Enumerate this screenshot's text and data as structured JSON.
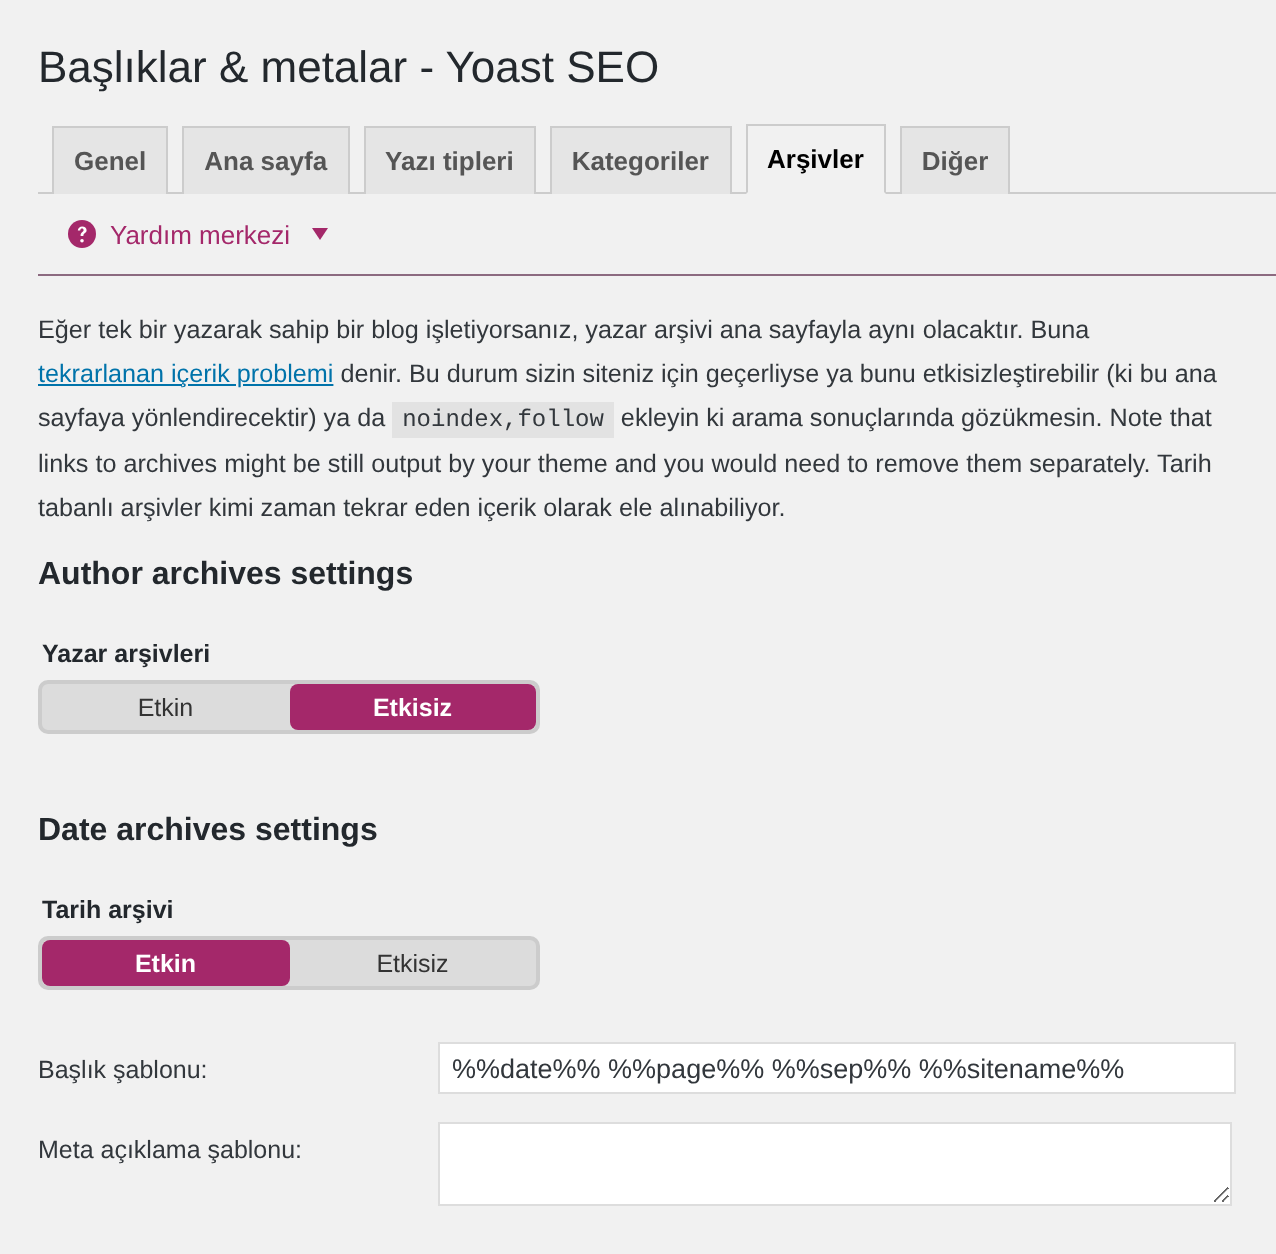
{
  "page": {
    "title": "Başlıklar & metalar - Yoast SEO"
  },
  "tabs": [
    {
      "label": "Genel",
      "selected": false
    },
    {
      "label": "Ana sayfa",
      "selected": false
    },
    {
      "label": "Yazı tipleri",
      "selected": false
    },
    {
      "label": "Kategoriler",
      "selected": false
    },
    {
      "label": "Arşivler",
      "selected": true
    },
    {
      "label": "Diğer",
      "selected": false
    }
  ],
  "help": {
    "label": "Yardım merkezi"
  },
  "intro": [
    {
      "kind": "text",
      "text": "Eğer tek bir yazarak sahip bir blog işletiyorsanız, yazar arşivi ana sayfayla aynı olacaktır. Buna "
    },
    {
      "kind": "link",
      "text": "tekrarlanan içerik problemi"
    },
    {
      "kind": "text",
      "text": " denir. Bu durum sizin siteniz için geçerliyse ya bunu etkisizleştirebilir (ki bu ana sayfaya yönlendirecektir) ya da "
    },
    {
      "kind": "code",
      "text": "noindex,follow"
    },
    {
      "kind": "text",
      "text": " ekleyin ki arama sonuçlarında gözükmesin. Note that links to archives might be still output by your theme and you would need to remove them separately. Tarih tabanlı arşivler kimi zaman tekrar eden içerik olarak ele alınabiliyor."
    }
  ],
  "sections": [
    {
      "heading": "Author archives settings",
      "toggle": {
        "label": "Yazar arşivleri",
        "options": [
          {
            "label": "Etkin",
            "selected": false
          },
          {
            "label": "Etkisiz",
            "selected": true
          }
        ]
      }
    },
    {
      "heading": "Date archives settings",
      "toggle": {
        "label": "Tarih arşivi",
        "options": [
          {
            "label": "Etkin",
            "selected": true
          },
          {
            "label": "Etkisiz",
            "selected": false
          }
        ]
      }
    }
  ],
  "fields": [
    {
      "kind": "input",
      "label": "Başlık şablonu:",
      "value": "%%date%% %%page%% %%sep%% %%sitename%%"
    },
    {
      "kind": "textarea",
      "label": "Meta açıklama şablonu:"
    }
  ]
}
